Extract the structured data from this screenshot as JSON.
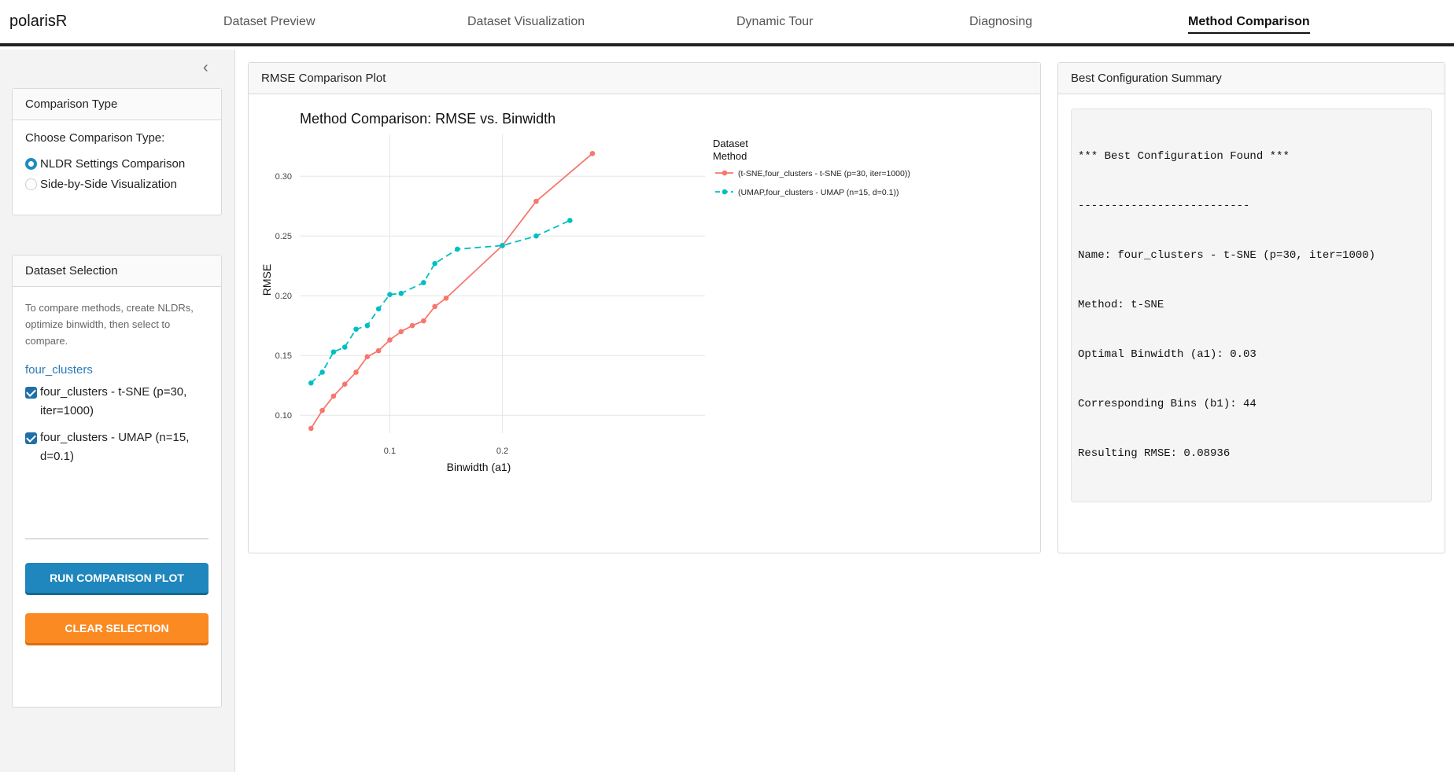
{
  "app": {
    "brand": "polarisR",
    "tabs": [
      {
        "label": "Dataset Preview",
        "active": false
      },
      {
        "label": "Dataset Visualization",
        "active": false
      },
      {
        "label": "Dynamic Tour",
        "active": false
      },
      {
        "label": "Diagnosing",
        "active": false
      },
      {
        "label": "Method Comparison",
        "active": true
      }
    ]
  },
  "sidebar": {
    "comparison_type": {
      "title": "Comparison Type",
      "prompt": "Choose Comparison Type:",
      "options": [
        {
          "label": "NLDR Settings Comparison",
          "selected": true
        },
        {
          "label": "Side-by-Side Visualization",
          "selected": false
        }
      ]
    },
    "dataset_selection": {
      "title": "Dataset Selection",
      "help": "To compare methods, create NLDRs, optimize binwidth, then select to compare.",
      "dataset_link": "four_clusters",
      "items": [
        {
          "label": "four_clusters - t-SNE (p=30, iter=1000)",
          "checked": true
        },
        {
          "label": "four_clusters - UMAP (n=15, d=0.1)",
          "checked": true
        }
      ]
    },
    "buttons": {
      "run": "RUN COMPARISON PLOT",
      "clear": "CLEAR SELECTION"
    }
  },
  "plot_panel": {
    "header": "RMSE Comparison Plot"
  },
  "summary_panel": {
    "header": "Best Configuration Summary",
    "lines": [
      "*** Best Configuration Found ***",
      "--------------------------",
      "Name: four_clusters - t-SNE (p=30, iter=1000)",
      "Method: t-SNE",
      "Optimal Binwidth (a1): 0.03",
      "Corresponding Bins (b1): 44",
      "Resulting RMSE: 0.08936"
    ]
  },
  "colors": {
    "tsne": "#F8766D",
    "umap": "#00BFC4",
    "accent_blue": "#1f87bd",
    "accent_orange": "#fb8a22"
  },
  "chart_data": {
    "type": "line",
    "title": "Method Comparison: RMSE vs. Binwidth",
    "xlabel": "Binwidth (a1)",
    "ylabel": "RMSE",
    "xlim": [
      0.02,
      0.38
    ],
    "ylim": [
      0.085,
      0.335
    ],
    "x_ticks": [
      0.1,
      0.2
    ],
    "x_tick_labels": [
      "0.1",
      "0.2"
    ],
    "y_ticks": [
      0.1,
      0.15,
      0.2,
      0.25,
      0.3
    ],
    "y_tick_labels": [
      "0.10",
      "0.15",
      "0.20",
      "0.25",
      "0.30"
    ],
    "grid": true,
    "legend_title": "Dataset\nMethod",
    "legend_position": "right",
    "series": [
      {
        "name": "(t-SNE,four_clusters - t-SNE (p=30, iter=1000))",
        "color": "#F8766D",
        "dash": "solid",
        "x": [
          0.03,
          0.04,
          0.05,
          0.06,
          0.07,
          0.08,
          0.09,
          0.1,
          0.11,
          0.12,
          0.13,
          0.14,
          0.15,
          0.2,
          0.23,
          0.28
        ],
        "y": [
          0.089,
          0.104,
          0.116,
          0.126,
          0.136,
          0.149,
          0.154,
          0.163,
          0.17,
          0.175,
          0.179,
          0.191,
          0.198,
          0.242,
          0.279,
          0.319
        ]
      },
      {
        "name": "(UMAP,four_clusters - UMAP (n=15, d=0.1))",
        "color": "#00BFC4",
        "dash": "dashed",
        "x": [
          0.03,
          0.04,
          0.05,
          0.06,
          0.07,
          0.08,
          0.09,
          0.1,
          0.11,
          0.13,
          0.14,
          0.16,
          0.2,
          0.23,
          0.26
        ],
        "y": [
          0.127,
          0.136,
          0.153,
          0.157,
          0.172,
          0.175,
          0.189,
          0.201,
          0.202,
          0.211,
          0.227,
          0.239,
          0.242,
          0.25,
          0.263
        ]
      }
    ]
  }
}
